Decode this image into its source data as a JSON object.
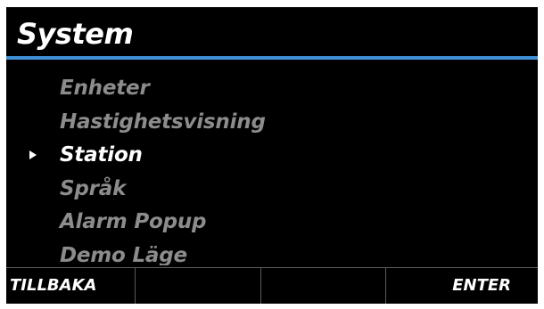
{
  "header": {
    "title": "System",
    "accent_color": "#3f8fd6"
  },
  "menu": {
    "selected_index": 2,
    "cursor_icon": "triangle-right-icon",
    "items": [
      {
        "label": "Enheter"
      },
      {
        "label": "Hastighetsvisning"
      },
      {
        "label": "Station"
      },
      {
        "label": "Språk"
      },
      {
        "label": "Alarm Popup"
      },
      {
        "label": "Demo Läge"
      }
    ]
  },
  "softkeys": [
    {
      "label": "TILLBAKA"
    },
    {
      "label": ""
    },
    {
      "label": ""
    },
    {
      "label": "ENTER"
    }
  ],
  "colors": {
    "background": "#000000",
    "text_selected": "#ffffff",
    "text_unselected": "#8c8c8c",
    "divider": "#5a5a5a"
  }
}
